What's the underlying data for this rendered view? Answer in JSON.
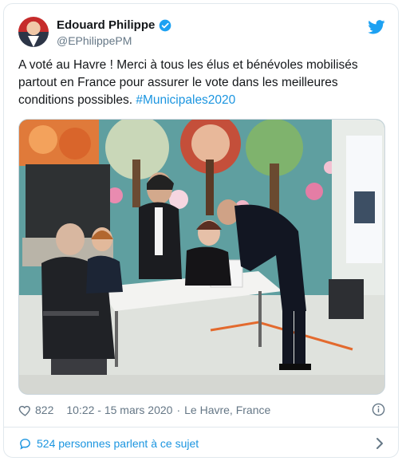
{
  "author": {
    "display_name": "Edouard Philippe",
    "handle": "@EPhilippePM",
    "avatar_icon": "profile-photo",
    "verified_icon": "verified-badge-icon"
  },
  "tweet": {
    "text_main": "A voté au Havre ! Merci à tous les élus et bénévoles mobilisés partout en France pour assurer le vote dans les meilleures conditions possibles. ",
    "hashtag": "#Municipales2020",
    "media_alt": "photo"
  },
  "meta": {
    "like_count": "822",
    "timestamp": "10:22 - 15 mars 2020",
    "separator": "·",
    "location": "Le Havre, France"
  },
  "footer": {
    "conversation_label": "524 personnes parlent à ce sujet"
  },
  "colors": {
    "link_blue": "#1b95e0",
    "secondary_text": "#657786",
    "verified_blue": "#1da1f2"
  }
}
